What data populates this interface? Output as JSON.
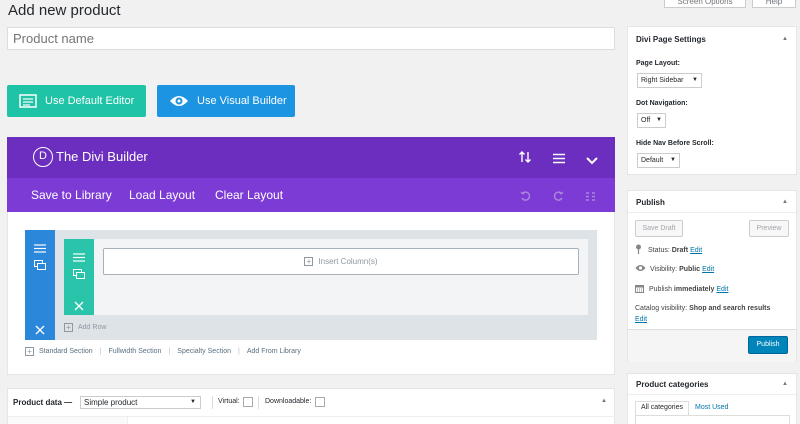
{
  "header": {
    "title": "Add new product",
    "screen_options": "Screen Options",
    "help": "Help"
  },
  "title_field": {
    "placeholder": "Product name"
  },
  "editor_buttons": {
    "default_editor": "Use Default Editor",
    "visual_builder": "Use Visual Builder"
  },
  "divi": {
    "logo_letter": "D",
    "title": "The Divi Builder",
    "toolbar": {
      "save_library": "Save to Library",
      "load_layout": "Load Layout",
      "clear_layout": "Clear Layout"
    },
    "insert_columns": "Insert Column(s)",
    "add_row": "Add Row",
    "section_links": [
      "Standard Section",
      "Fullwidth Section",
      "Specialty Section",
      "Add From Library"
    ]
  },
  "product_data": {
    "label": "Product data —",
    "type_value": "Simple product",
    "virtual_label": "Virtual:",
    "downloadable_label": "Downloadable:"
  },
  "sidebar": {
    "divi_settings": {
      "title": "Divi Page Settings",
      "page_layout_label": "Page Layout:",
      "page_layout_value": "Right Sidebar",
      "dot_nav_label": "Dot Navigation:",
      "dot_nav_value": "Off",
      "hide_nav_label": "Hide Nav Before Scroll:",
      "hide_nav_value": "Default"
    },
    "publish": {
      "title": "Publish",
      "save_draft": "Save Draft",
      "preview": "Preview",
      "status_label": "Status:",
      "status_value": "Draft",
      "visibility_label": "Visibility:",
      "visibility_value": "Public",
      "publish_label": "Publish",
      "publish_value": "immediately",
      "edit": "Edit",
      "catalog_label": "Catalog visibility:",
      "catalog_value": "Shop and search results",
      "publish_button": "Publish"
    },
    "categories": {
      "title": "Product categories",
      "tab_all": "All categories",
      "tab_most_used": "Most Used"
    }
  },
  "colors": {
    "divi_purple": "#6c2ebe",
    "divi_toolbar": "#7c3bd4",
    "teal": "#1ec4a5",
    "blue": "#1d94e1",
    "wp_blue": "#0085ba"
  }
}
